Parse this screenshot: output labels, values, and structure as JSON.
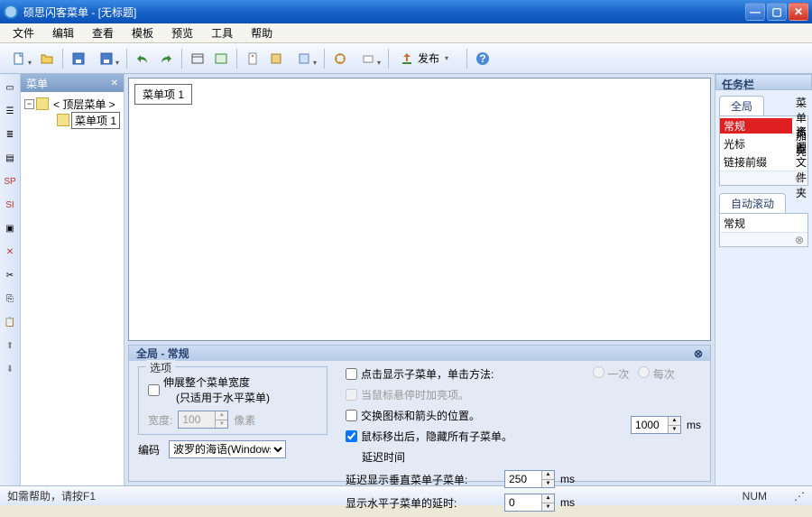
{
  "title": "硕思闪客菜单  - [无标题]",
  "menus": [
    "文件",
    "编辑",
    "查看",
    "模板",
    "预览",
    "工具",
    "帮助"
  ],
  "publish_label": "发布",
  "menu_panel_title": "菜单",
  "tree": {
    "root": "< 顶层菜单 >",
    "item1": "菜单项 1"
  },
  "canvas_item": "菜单项 1",
  "props": {
    "header": "全局 - 常规",
    "options_legend": "选项",
    "stretch_label": "伸展整个菜单宽度",
    "stretch_note": "(只适用于水平菜单)",
    "width_label": "宽度:",
    "width_value": "100",
    "width_unit": "像素",
    "encoding_label": "编码",
    "encoding_value": "波罗的海语(Windows)",
    "click_show": "点击显示子菜单，单击方法:",
    "hover_highlight": "当鼠标悬停时加亮项。",
    "swap_icon": "交换图标和箭头的位置。",
    "mouseout_hide": "鼠标移出后，隐藏所有子菜单。",
    "delay_label": "延迟时间",
    "hide_value": "1000",
    "vertical_label": "延迟显示垂直菜单子菜单:",
    "vertical_value": "250",
    "horizontal_label": "显示水平子菜单的延时:",
    "horizontal_value": "0",
    "ms": "ms",
    "radio_once": "一次",
    "radio_each": "每次"
  },
  "taskbar": {
    "title": "任务栏",
    "tab1": "全局",
    "rows": [
      {
        "c1": "常规",
        "c2": "菜单类型",
        "sel": true
      },
      {
        "c1": "光标",
        "c2": "加亮"
      },
      {
        "c1": "链接前缀",
        "c2": "资源文件夹"
      }
    ],
    "tab2": "自动滚动",
    "rows2": [
      {
        "c1": "常规",
        "c2": ""
      }
    ]
  },
  "status": {
    "left": "如需帮助，请按F1",
    "num": "NUM"
  }
}
